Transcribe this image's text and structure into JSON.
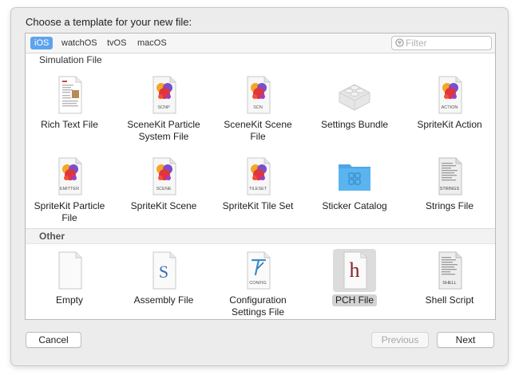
{
  "dialog": {
    "prompt": "Choose a template for your new file:"
  },
  "tabs": [
    {
      "label": "iOS",
      "active": true
    },
    {
      "label": "watchOS",
      "active": false
    },
    {
      "label": "tvOS",
      "active": false
    },
    {
      "label": "macOS",
      "active": false
    }
  ],
  "filter": {
    "placeholder": "Filter",
    "value": ""
  },
  "sections": {
    "simulation": "Simulation File",
    "other": "Other"
  },
  "items": {
    "rich_text": {
      "label": "Rich Text File",
      "icon": "rich-text-document-icon"
    },
    "scenekit_particle": {
      "label": "SceneKit Particle System File",
      "icon": "scenekit-particle-icon",
      "badge": "SCNP"
    },
    "scenekit_scene": {
      "label": "SceneKit Scene File",
      "icon": "scenekit-scene-icon",
      "badge": "SCN"
    },
    "settings_bundle": {
      "label": "Settings Bundle",
      "icon": "lego-brick-icon"
    },
    "spritekit_action": {
      "label": "SpriteKit Action",
      "icon": "spritekit-action-icon",
      "badge": "ACTION"
    },
    "spritekit_particle": {
      "label": "SpriteKit Particle File",
      "icon": "spritekit-emitter-icon",
      "badge": "EMITTER"
    },
    "spritekit_scene": {
      "label": "SpriteKit Scene",
      "icon": "spritekit-scene-icon",
      "badge": "SCENE"
    },
    "spritekit_tileset": {
      "label": "SpriteKit Tile Set",
      "icon": "spritekit-tileset-icon",
      "badge": "TILESET"
    },
    "sticker_catalog": {
      "label": "Sticker Catalog",
      "icon": "blue-folder-icon"
    },
    "strings_file": {
      "label": "Strings File",
      "icon": "strings-file-icon",
      "badge": "STRINGS"
    },
    "empty": {
      "label": "Empty",
      "icon": "blank-file-icon"
    },
    "assembly": {
      "label": "Assembly File",
      "icon": "assembly-file-icon",
      "glyph": "S"
    },
    "config": {
      "label": "Configuration Settings File",
      "icon": "config-file-icon",
      "badge": "CONFIG"
    },
    "pch": {
      "label": "PCH File",
      "icon": "pch-file-icon",
      "glyph": "h",
      "selected": true
    },
    "shell": {
      "label": "Shell Script",
      "icon": "shell-script-icon",
      "badge": "SHELL"
    }
  },
  "buttons": {
    "cancel": "Cancel",
    "previous": "Previous",
    "next": "Next"
  },
  "colors": {
    "selected_tab": "#5ea3ee",
    "swift_orange": "#f05138",
    "folder_blue": "#5ab4f0",
    "pch_maroon": "#8a1f2b",
    "assembly_blue": "#3b6fb3"
  }
}
